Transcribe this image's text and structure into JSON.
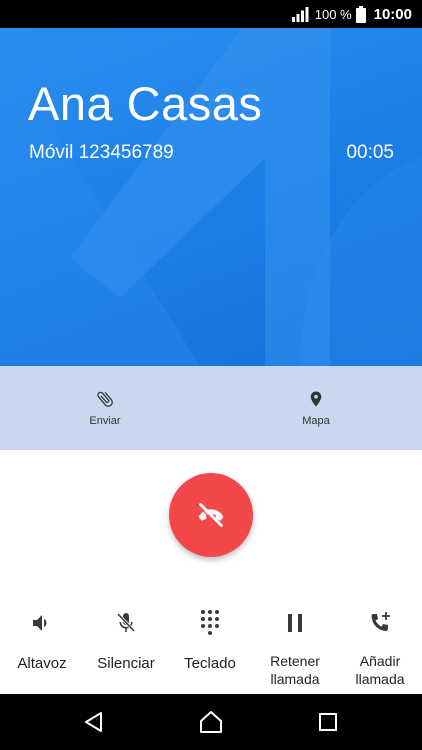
{
  "status_bar": {
    "battery_text": "100 %",
    "time": "10:00",
    "icons": [
      "signal-icon",
      "battery-icon"
    ]
  },
  "caller": {
    "name": "Ana Casas",
    "number": "Móvil 123456789",
    "timer": "00:05"
  },
  "actions": {
    "send_label": "Enviar",
    "map_label": "Mapa",
    "icons": [
      "paperclip-icon",
      "location-pin-icon"
    ]
  },
  "end_call": {
    "icon": "end-call-icon",
    "color": "#f4474a"
  },
  "controls": {
    "speaker_label": "Altavoz",
    "mute_label": "Silenciar",
    "keypad_label": "Teclado",
    "hold_label": "Retener\nllamada",
    "add_call_label": "Añadir\nllamada",
    "icons": [
      "speaker-icon",
      "mic-off-icon",
      "dialpad-icon",
      "pause-icon",
      "add-call-icon"
    ]
  },
  "nav": {
    "icons": [
      "back-icon",
      "home-icon",
      "recents-icon"
    ]
  },
  "colors": {
    "header_blue": "#1b7ee6",
    "strip": "#c9d8ee",
    "end_call_red": "#f4474a"
  }
}
